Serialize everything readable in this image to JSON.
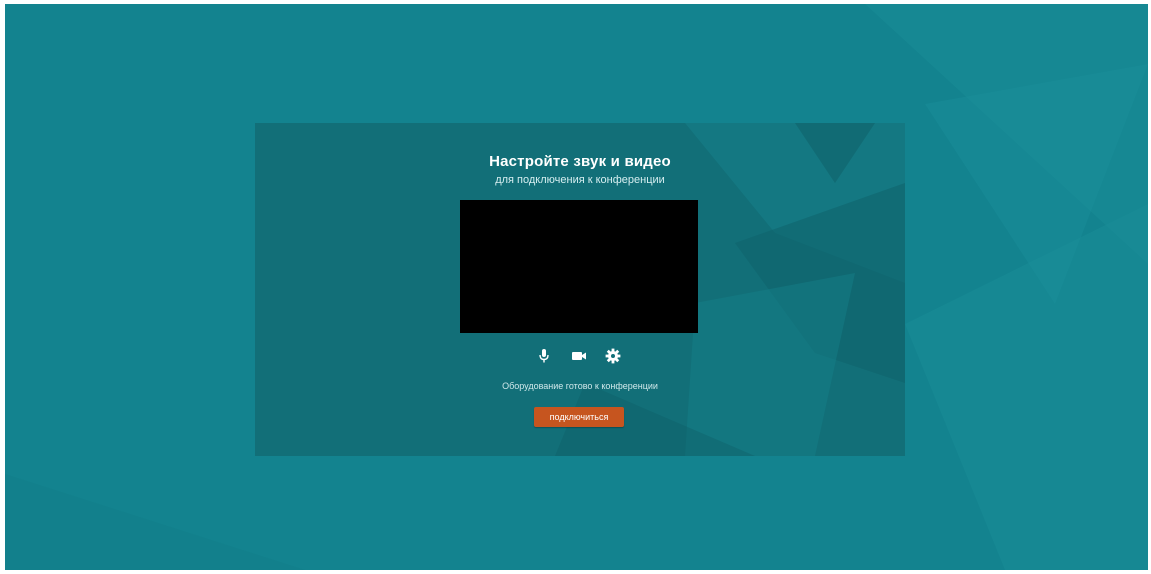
{
  "setup": {
    "title": "Настройте звук и видео",
    "subtitle": "для подключения к конференции",
    "status": "Оборудование готово к конференции",
    "join_label": "подключиться"
  },
  "controls": [
    {
      "icon": "microphone-icon"
    },
    {
      "icon": "camera-icon"
    },
    {
      "icon": "gear-icon"
    }
  ],
  "colors": {
    "background": "#13838f",
    "panel": "#126f78",
    "video_preview": "#000000",
    "join_button": "#c6551f",
    "text": "#ffffff"
  }
}
